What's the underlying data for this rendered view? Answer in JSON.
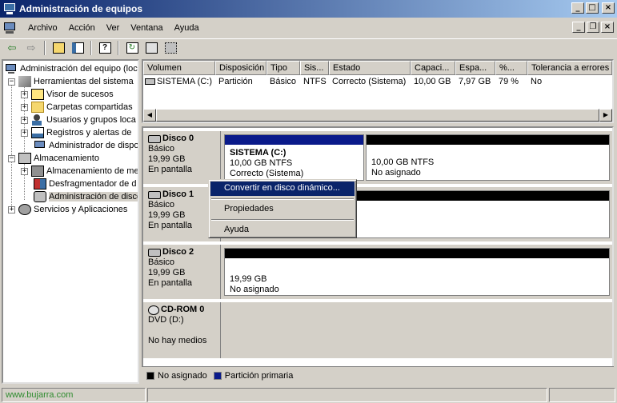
{
  "window": {
    "title": "Administración de equipos"
  },
  "menubar": {
    "items": [
      {
        "label": "Archivo"
      },
      {
        "label": "Acción"
      },
      {
        "label": "Ver"
      },
      {
        "label": "Ventana"
      },
      {
        "label": "Ayuda"
      }
    ]
  },
  "tree": {
    "root": "Administración del equipo (loca",
    "items": [
      {
        "label": "Herramientas del sistema"
      },
      {
        "label": "Visor de sucesos"
      },
      {
        "label": "Carpetas compartidas"
      },
      {
        "label": "Usuarios y grupos loca"
      },
      {
        "label": "Registros y alertas de"
      },
      {
        "label": "Administrador de dispo"
      },
      {
        "label": "Almacenamiento"
      },
      {
        "label": "Almacenamiento de me"
      },
      {
        "label": "Desfragmentador de d"
      },
      {
        "label": "Administración de disco"
      },
      {
        "label": "Servicios y Aplicaciones"
      }
    ]
  },
  "volumes": {
    "columns": [
      "Volumen",
      "Disposición",
      "Tipo",
      "Sis...",
      "Estado",
      "Capaci...",
      "Espa...",
      "%...",
      "Tolerancia a errores"
    ],
    "rows": [
      [
        "SISTEMA (C:)",
        "Partición",
        "Básico",
        "NTFS",
        "Correcto (Sistema)",
        "10,00 GB",
        "7,97 GB",
        "79 %",
        "No"
      ]
    ]
  },
  "disks": [
    {
      "name": "Disco 0",
      "type": "Básico",
      "size": "19,99 GB",
      "status": "En pantalla",
      "partitions": [
        {
          "name": "SISTEMA  (C:)",
          "size": "10,00 GB NTFS",
          "status": "Correcto (Sistema)"
        },
        {
          "size": "10,00 GB NTFS",
          "status": "No asignado"
        }
      ]
    },
    {
      "name": "Disco 1",
      "type": "Básico",
      "size": "19,99 GB",
      "status": "En pantalla"
    },
    {
      "name": "Disco 2",
      "type": "Básico",
      "size": "19,99 GB",
      "status": "En pantalla",
      "partitions": [
        {
          "size": "19,99 GB",
          "status": "No asignado"
        }
      ]
    },
    {
      "name": "CD-ROM 0",
      "type": "DVD (D:)",
      "status": "No hay medios"
    }
  ],
  "legend": {
    "unallocated": "No asignado",
    "primary": "Partición primaria"
  },
  "context_menu": {
    "items": [
      "Convertir en disco dinámico...",
      "Propiedades",
      "Ayuda"
    ]
  },
  "statusbar": {
    "text": "www.bujarra.com"
  },
  "colors": {
    "primary_partition": "#0a1a8a",
    "unallocated": "#000000"
  }
}
